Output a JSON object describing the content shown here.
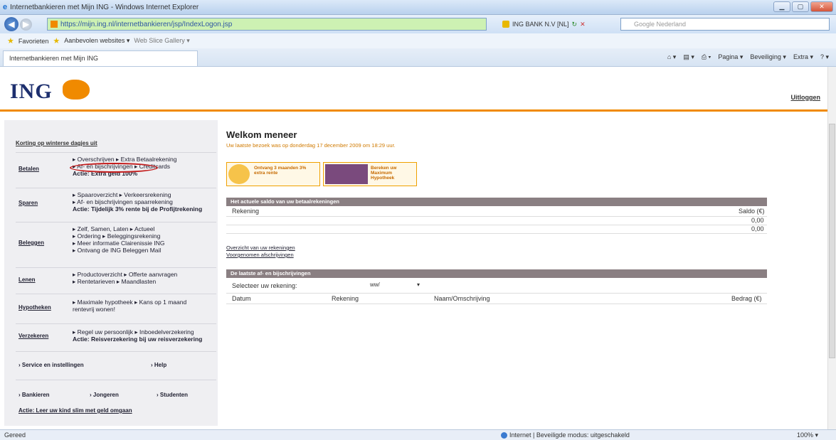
{
  "browser": {
    "window_title": "Internetbankieren met Mijn ING - Windows Internet Explorer",
    "address_url": "https://mijn.ing.nl/internetbankieren/jsp/IndexLogon.jsp",
    "cert_label": "ING BANK N.V [NL]",
    "search_placeholder": "Google Nederland",
    "favorites": {
      "label": "Favorieten",
      "suggested": "Aanbevolen websites ▾",
      "webslice": "Web Slice Gallery ▾"
    },
    "tab_title": "Internetbankieren met Mijn ING",
    "toolbar": {
      "page": "Pagina ▾",
      "security": "Beveiliging ▾",
      "extra": "Extra ▾"
    },
    "status": {
      "left": "Gereed",
      "zone": "Internet | Beveiligde modus: uitgeschakeld",
      "zoom": "100% ▾"
    }
  },
  "site": {
    "logo_text": "ING",
    "logout": "Uitloggen"
  },
  "sidebar": {
    "header": "Korting op winterse dagjes uit",
    "sections": [
      {
        "label": "Betalen",
        "lines": [
          "▸ Overschrijven ▸ Extra Betaalrekening",
          "▸ Af- en bijschrijvingen ▸ Creditcards",
          "Actie: Extra geld 100%"
        ]
      },
      {
        "label": "Sparen",
        "lines": [
          "▸ Spaaroverzicht ▸ Verkeersrekening",
          "▸ Af- en bijschrijvingen spaarrekening",
          "Actie: Tijdelijk 3% rente bij de Profijtrekening"
        ]
      },
      {
        "label": "Beleggen",
        "lines": [
          "▸ Zelf, Samen, Laten ▸ Actueel",
          "▸ Ordering ▸ Beleggingsrekening",
          "▸ Meer informatie Clairenissie ING",
          "▸ Ontvang de ING Beleggen Mail"
        ]
      },
      {
        "label": "Lenen",
        "lines": [
          "▸ Productoverzicht ▸ Offerte aanvragen",
          "▸ Rentetarieven ▸ Maandlasten"
        ]
      },
      {
        "label": "Hypotheken",
        "lines": [
          "▸ Maximale hypotheek ▸ Kans op 1 maand",
          "rentevrij wonen!"
        ]
      },
      {
        "label": "Verzekeren",
        "lines": [
          "▸ Regel uw persoonlijk ▸ Inboedelverzekering",
          "Actie: Reisverzekering bij uw reisverzekering"
        ]
      }
    ],
    "service": "› Service en instellingen",
    "help": "› Help",
    "footer_links": [
      "› Bankieren",
      "› Jongeren",
      "› Studenten"
    ],
    "footer_action": "Actie: Leer uw kind slim met geld omgaan"
  },
  "main": {
    "welcome": "Welkom meneer",
    "last_visit": "Uw laatste bezoek was op donderdag 17 december 2009 om 18:29 uur.",
    "banner1": "Ontvang 3 maanden 3% extra rente",
    "banner2": "Bereken uw Maximum Hypotheek",
    "saldo_header": "Het actuele saldo van uw betaalrekeningen",
    "rekening_col": "Rekening",
    "saldo_col": "Saldo (€)",
    "saldo_rows": [
      "0,00",
      "0,00"
    ],
    "link_overview": "Overzicht van uw rekeningen",
    "link_pending": "Voorgenomen afschrijvingen",
    "tx_header": "De laatste af- en bijschrijvingen",
    "select_label": "Selecteer uw rekening:",
    "select_value": "ww/",
    "tx_cols": [
      "Datum",
      "Rekening",
      "Naam/Omschrijving",
      "Bedrag (€)"
    ]
  }
}
